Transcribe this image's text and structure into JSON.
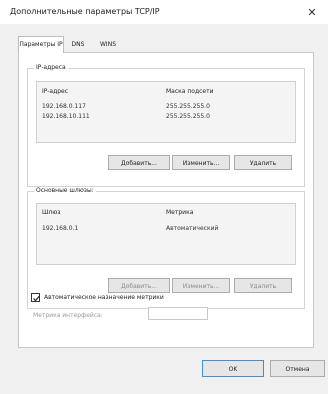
{
  "window": {
    "title": "Дополнительные параметры TCP/IP"
  },
  "tabs": [
    "Параметры IP",
    "DNS",
    "WINS"
  ],
  "ip": {
    "group_label": "IP-адреса",
    "col_ip": "IP-адрес",
    "col_mask": "Маска подсети",
    "rows": [
      {
        "ip": "192.168.0.117",
        "mask": "255.255.255.0"
      },
      {
        "ip": "192.168.10.111",
        "mask": "255.255.255.0"
      }
    ],
    "add": "Добавить...",
    "edit": "Изменить...",
    "remove": "Удалить"
  },
  "gateway": {
    "group_label": "Основные шлюзы:",
    "col_gateway": "Шлюз",
    "col_metric": "Метрика",
    "rows": [
      {
        "gateway": "192.168.0.1",
        "metric": "Автоматический"
      }
    ],
    "add": "Добавить...",
    "edit": "Изменить...",
    "remove": "Удалить"
  },
  "auto_metric": {
    "label": "Автоматическое назначение метрики",
    "checked": true,
    "interface_metric_label": "Метрика интерфейса:",
    "interface_metric_value": ""
  },
  "footer": {
    "ok": "OK",
    "cancel": "Отмена"
  }
}
